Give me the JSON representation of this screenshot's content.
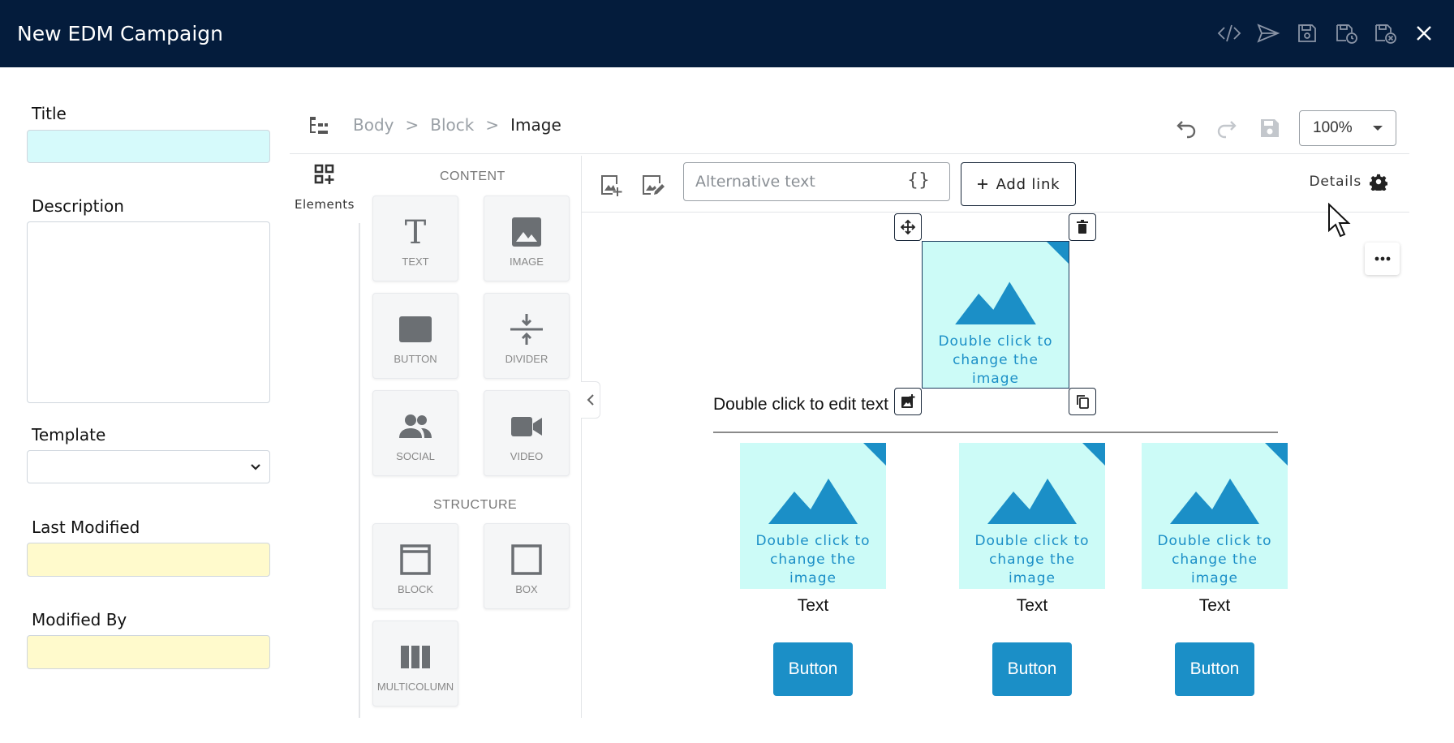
{
  "window": {
    "title": "New EDM Campaign"
  },
  "titlebar_icons": [
    "code-icon",
    "send-icon",
    "save-icon",
    "save-schedule-icon",
    "save-close-icon",
    "close-icon"
  ],
  "form": {
    "title_label": "Title",
    "title_value": "",
    "description_label": "Description",
    "description_value": "",
    "template_label": "Template",
    "template_value": "",
    "last_modified_label": "Last Modified",
    "last_modified_value": "",
    "modified_by_label": "Modified By",
    "modified_by_value": ""
  },
  "breadcrumb": {
    "items": [
      "Body",
      "Block",
      "Image"
    ],
    "separator": ">"
  },
  "zoom": {
    "value": "100%"
  },
  "panel": {
    "tab_label": "Elements",
    "content_title": "CONTENT",
    "structure_title": "STRUCTURE",
    "content_items": [
      "TEXT",
      "IMAGE",
      "BUTTON",
      "DIVIDER",
      "SOCIAL",
      "VIDEO"
    ],
    "structure_items": [
      "BLOCK",
      "BOX",
      "MULTICOLUMN"
    ]
  },
  "image_toolbar": {
    "alt_placeholder": "Alternative text",
    "braces": "{}",
    "add_link_label": "Add link",
    "details_label": "Details"
  },
  "canvas": {
    "image_placeholder_text": "Double click to change the image",
    "edit_text": "Double click to edit text",
    "columns": [
      {
        "text": "Text",
        "button": "Button"
      },
      {
        "text": "Text",
        "button": "Button"
      },
      {
        "text": "Text",
        "button": "Button"
      }
    ]
  },
  "colors": {
    "titlebar": "#041c3c",
    "accent": "#1b8fc7",
    "placeholder_bg": "#ccfbf7",
    "title_input": "#d6fafb",
    "readonly_input": "#fffacc"
  }
}
